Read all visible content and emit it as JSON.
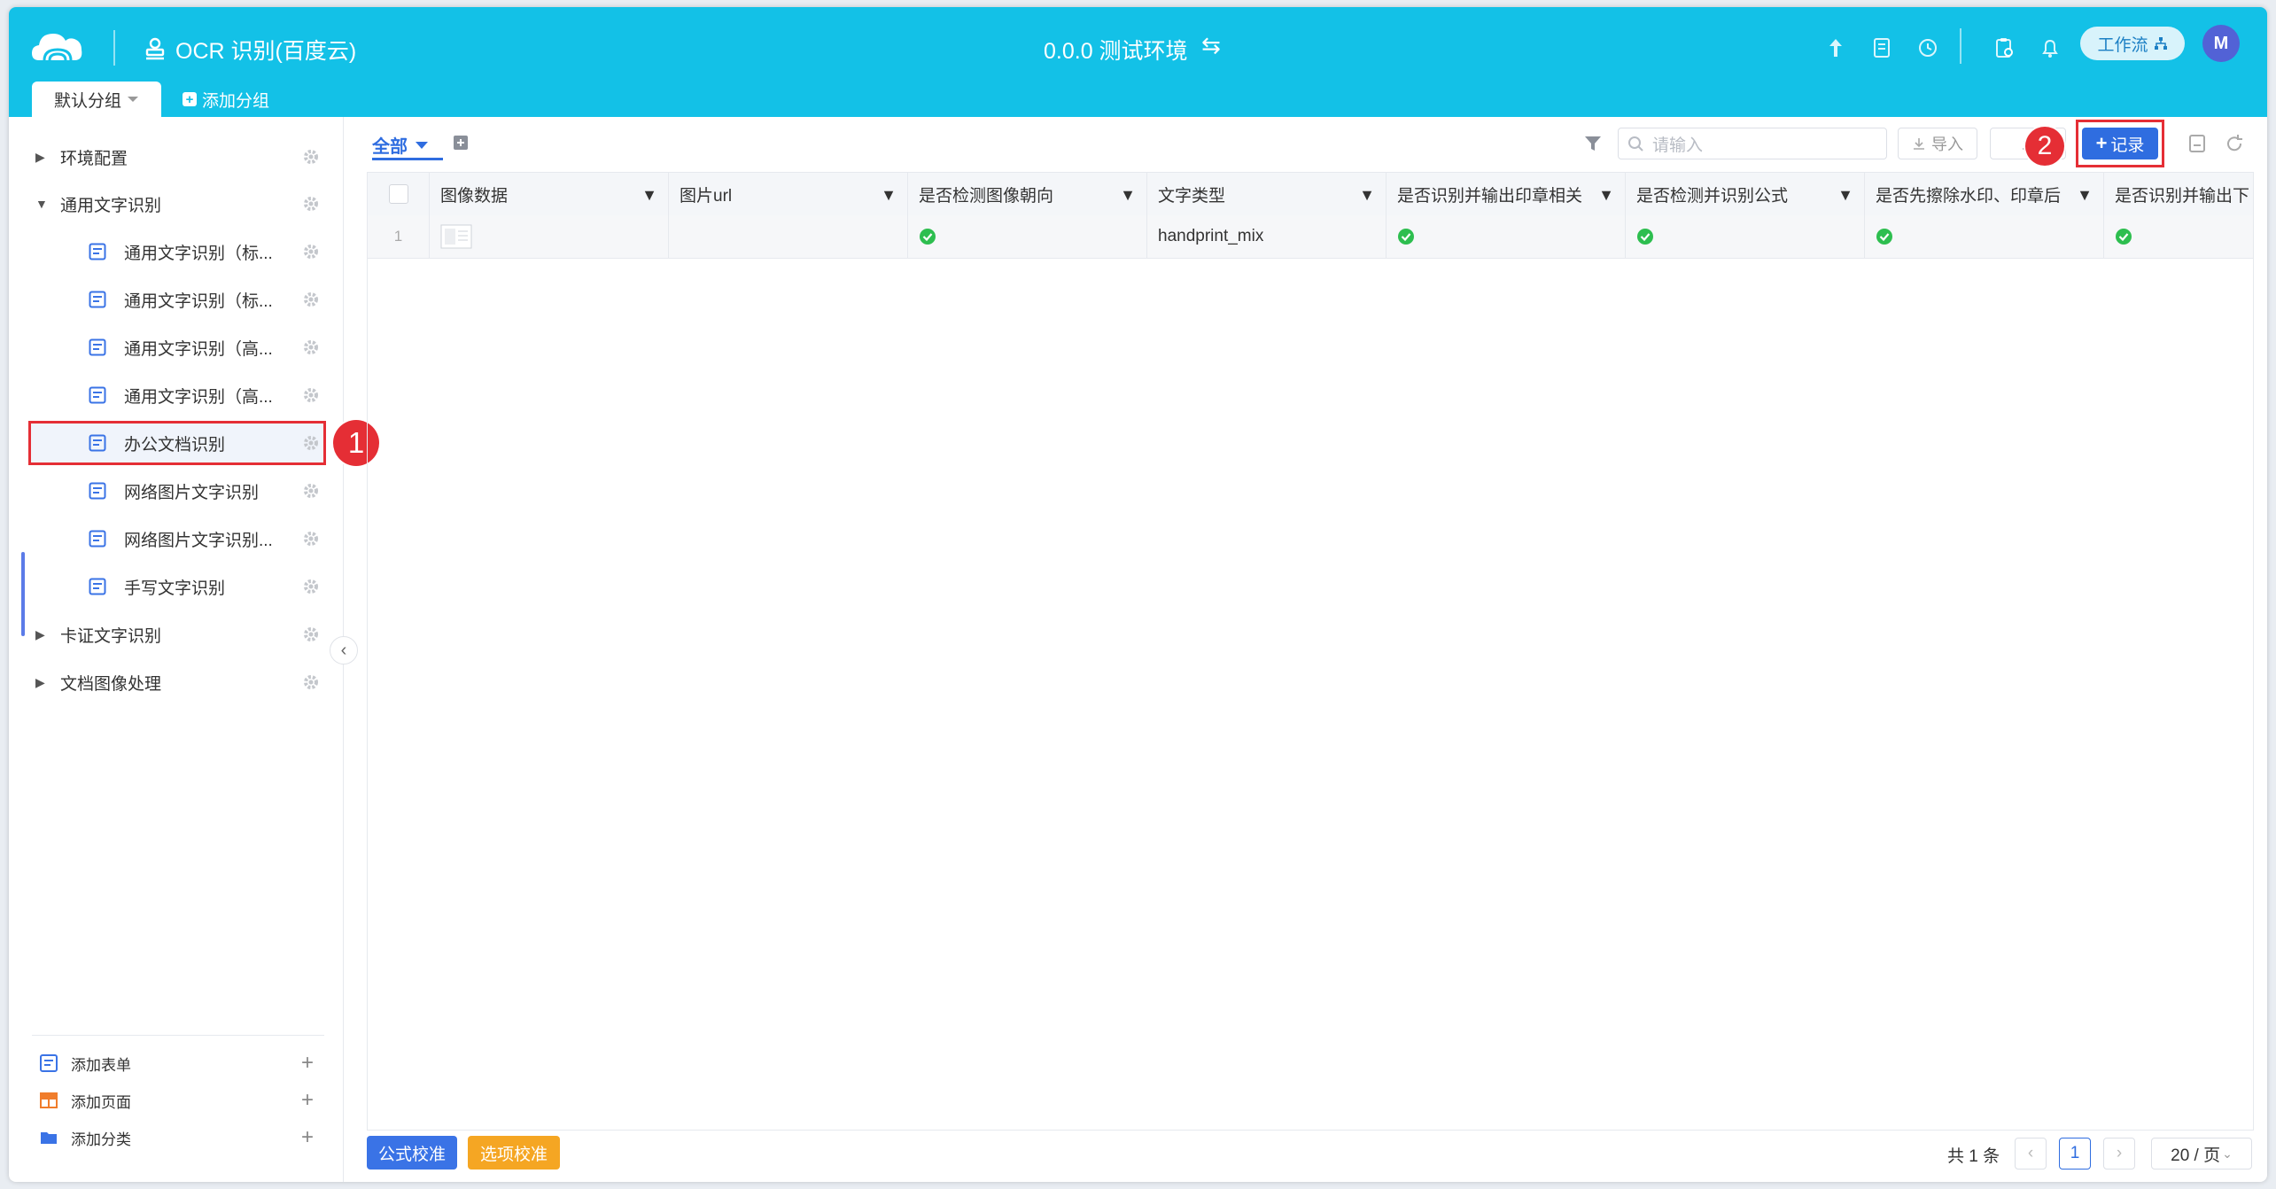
{
  "header": {
    "app_title": "OCR 识别(百度云)",
    "environment": "0.0.0 测试环境",
    "env_swap_glyph": "⇆",
    "workflow_label": "工作流",
    "avatar_initial": "M",
    "colors": {
      "bar": "#13c1e7",
      "avatar": "#5262d6"
    }
  },
  "group_tabs": {
    "default_label": "默认分组",
    "add_label": "添加分组"
  },
  "sidebar": {
    "tree": [
      {
        "label": "环境配置",
        "type": "folder",
        "expanded": false
      },
      {
        "label": "通用文字识别",
        "type": "folder",
        "expanded": true
      },
      {
        "label": "通用文字识别（标...",
        "type": "form"
      },
      {
        "label": "通用文字识别（标...",
        "type": "form"
      },
      {
        "label": "通用文字识别（高...",
        "type": "form"
      },
      {
        "label": "通用文字识别（高...",
        "type": "form"
      },
      {
        "label": "办公文档识别",
        "type": "form",
        "selected": true
      },
      {
        "label": "网络图片文字识别",
        "type": "form"
      },
      {
        "label": "网络图片文字识别...",
        "type": "form"
      },
      {
        "label": "手写文字识别",
        "type": "form"
      },
      {
        "label": "卡证文字识别",
        "type": "folder",
        "expanded": false
      },
      {
        "label": "文档图像处理",
        "type": "folder",
        "expanded": false
      }
    ],
    "bottom": [
      {
        "label": "添加表单",
        "icon": "form-icon"
      },
      {
        "label": "添加页面",
        "icon": "table-page-icon"
      },
      {
        "label": "添加分类",
        "icon": "folder-icon"
      }
    ]
  },
  "annotations": {
    "badge1": "1",
    "badge2": "2",
    "color": "#e52e35"
  },
  "toolbar": {
    "view_label": "全部",
    "search_placeholder": "请输入",
    "import_label": "导入",
    "record_label": "记录"
  },
  "grid": {
    "columns": [
      "图像数据",
      "图片url",
      "是否检测图像朝向",
      "文字类型",
      "是否识别并输出印章相关",
      "是否检测并识别公式",
      "是否先擦除水印、印章后",
      "是否识别并输出下"
    ],
    "rows": [
      {
        "index": "1",
        "image": "thumbnail",
        "url": "",
        "detect_direction": true,
        "text_type": "handprint_mix",
        "seal": true,
        "formula": true,
        "erase_watermark": true,
        "output_last": true
      }
    ]
  },
  "footer": {
    "formula_btn": "公式校准",
    "option_btn": "选项校准",
    "total": "共 1 条",
    "current_page": "1",
    "page_size": "20 / 页",
    "colors": {
      "formula": "#3a73e6",
      "option": "#f5a623"
    }
  }
}
